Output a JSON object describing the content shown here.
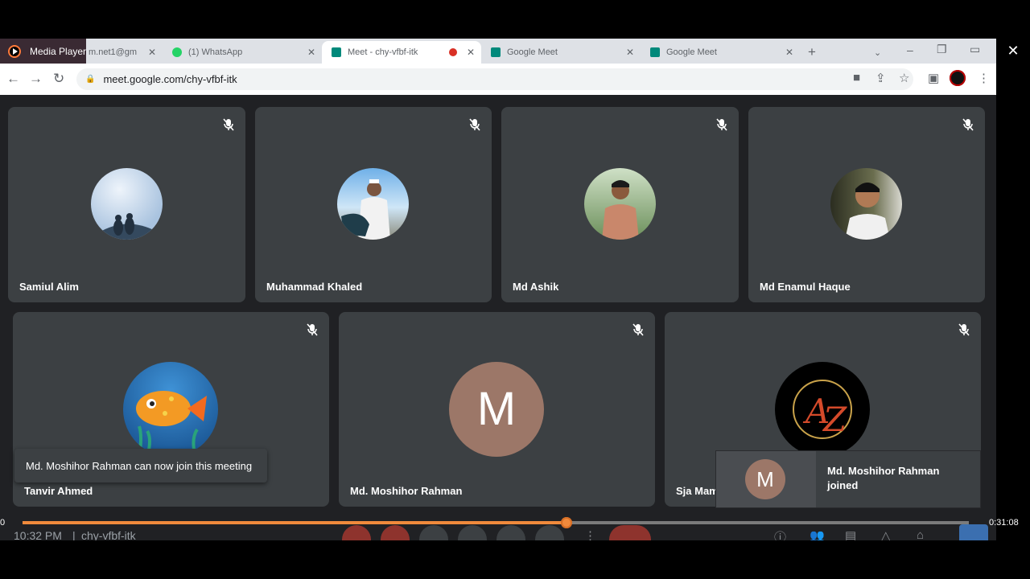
{
  "media_player": {
    "title": "Media Player"
  },
  "browser": {
    "tabs": [
      {
        "title": "m.net1@gm",
        "color": "#4285f4"
      },
      {
        "title": "(1) WhatsApp",
        "color": "#25d366"
      },
      {
        "title": "Meet - chy-vfbf-itk",
        "color": "#00897b"
      },
      {
        "title": "Google Meet",
        "color": "#00897b"
      },
      {
        "title": "Google Meet",
        "color": "#00897b"
      }
    ],
    "url": "meet.google.com/chy-vfbf-itk"
  },
  "participants": [
    {
      "name": "Samiul Alim",
      "avatar": "birds-photo",
      "muted": true
    },
    {
      "name": "Muhammad Khaled",
      "avatar": "person-photo",
      "muted": true
    },
    {
      "name": "Md Ashik",
      "avatar": "person-photo",
      "muted": true
    },
    {
      "name": "Md Enamul Haque",
      "avatar": "person-photo",
      "muted": true
    },
    {
      "name": "Tanvir Ahmed",
      "avatar": "fish-illustration",
      "muted": true
    },
    {
      "name": "Md. Moshihor Rahman",
      "avatar_letter": "M",
      "avatar_color": "#9c7768",
      "muted": true
    },
    {
      "name": "Sja Mam",
      "avatar": "a-to-z-logo",
      "muted": true
    }
  ],
  "toast": {
    "text": "Md. Moshihor Rahman can now join this meeting"
  },
  "join_notification": {
    "letter": "M",
    "text": "Md. Moshihor Rahman joined"
  },
  "meeting": {
    "time": "10:32 PM",
    "separator": "|",
    "code": "chy-vfbf-itk"
  },
  "player": {
    "elapsed": "0",
    "duration": "0:31:08",
    "progress": 0.575
  }
}
